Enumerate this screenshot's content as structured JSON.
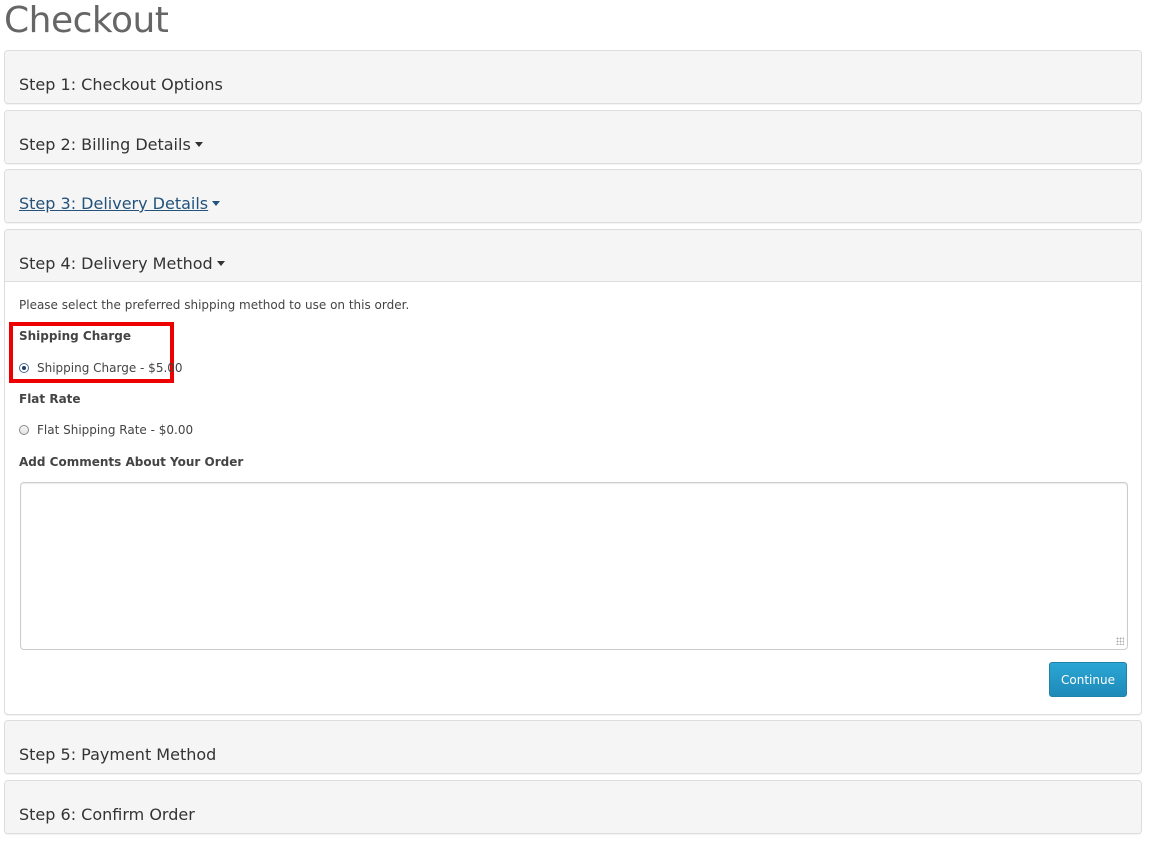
{
  "page": {
    "title": "Checkout"
  },
  "steps": [
    {
      "label": "Step 1: Checkout Options",
      "has_caret": false,
      "is_link": false
    },
    {
      "label": "Step 2: Billing Details",
      "has_caret": true,
      "is_link": false
    },
    {
      "label": "Step 3: Delivery Details",
      "has_caret": true,
      "is_link": true
    },
    {
      "label": "Step 4: Delivery Method",
      "has_caret": true,
      "is_link": false,
      "expanded": true
    },
    {
      "label": "Step 5: Payment Method",
      "has_caret": false,
      "is_link": false
    },
    {
      "label": "Step 6: Confirm Order",
      "has_caret": false,
      "is_link": false
    }
  ],
  "delivery_method": {
    "intro": "Please select the preferred shipping method to use on this order.",
    "groups": [
      {
        "title": "Shipping Charge",
        "option": "Shipping Charge - $5.00",
        "selected": true
      },
      {
        "title": "Flat Rate",
        "option": "Flat Shipping Rate - $0.00",
        "selected": false
      }
    ],
    "comments_label": "Add Comments About Your Order",
    "comments_value": "",
    "continue_label": "Continue"
  },
  "colors": {
    "link": "#23527c",
    "highlight": "#ee0000",
    "button": "#1e8ab8"
  }
}
